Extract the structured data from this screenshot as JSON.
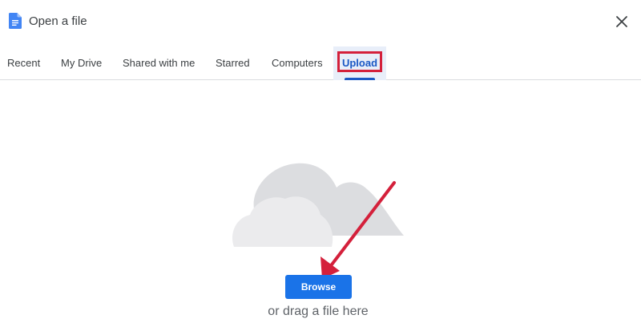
{
  "dialog": {
    "title": "Open a file",
    "close_icon": "close-icon",
    "doc_icon": "google-docs-icon"
  },
  "tabs": [
    {
      "label": "Recent"
    },
    {
      "label": "My Drive"
    },
    {
      "label": "Shared with me"
    },
    {
      "label": "Starred"
    },
    {
      "label": "Computers"
    },
    {
      "label": "Upload",
      "selected": true
    }
  ],
  "upload": {
    "illustration": "cloud-icon",
    "browse_label": "Browse",
    "drag_text": "or drag a file here"
  },
  "colors": {
    "accent": "#1a73e8",
    "selected_tab_text": "#1a58c4",
    "selected_tab_bg": "#e8eef9",
    "highlight": "#d4203b",
    "annotation_arrow": "#d4203b",
    "cloud": "#e3e4e6"
  }
}
